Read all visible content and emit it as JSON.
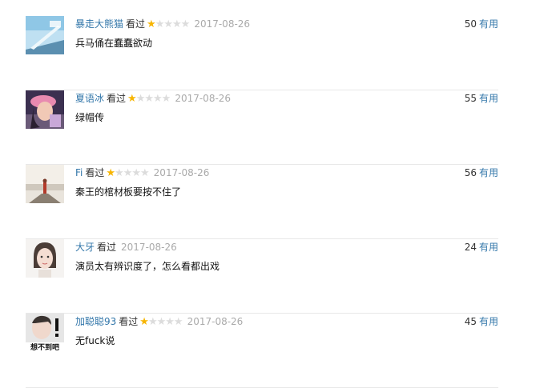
{
  "comments": [
    {
      "user": "暴走大熊猫",
      "status": "看过",
      "rating": 1,
      "max_rating": 5,
      "date": "2017-08-26",
      "text": "兵马俑在蠢蠢欲动",
      "votes": "50",
      "vote_label": "有用",
      "avatar": "avatar-stairs-sky"
    },
    {
      "user": "夏语冰",
      "status": "看过",
      "rating": 1,
      "max_rating": 5,
      "date": "2017-08-26",
      "text": "绿帽传",
      "votes": "55",
      "vote_label": "有用",
      "avatar": "avatar-girl-pink-hat"
    },
    {
      "user": "Fi",
      "status": "看过",
      "rating": 1,
      "max_rating": 5,
      "date": "2017-08-26",
      "text": "秦王的棺材板要按不住了",
      "votes": "56",
      "vote_label": "有用",
      "avatar": "avatar-figure-on-rock-sea"
    },
    {
      "user": "大牙",
      "status": "看过",
      "rating": null,
      "max_rating": 5,
      "date": "2017-08-26",
      "text": "演员太有辨识度了，怎么看都出戏",
      "votes": "24",
      "vote_label": "有用",
      "avatar": "avatar-girl-portrait"
    },
    {
      "user": "加聪聪93",
      "status": "看过",
      "rating": 1,
      "max_rating": 5,
      "date": "2017-08-26",
      "text": "无fuck说",
      "votes": "45",
      "vote_label": "有用",
      "avatar": "avatar-meme-face",
      "avatar_caption": "想不到吧"
    }
  ],
  "colors": {
    "link": "#3377aa",
    "star_on": "#f7b500",
    "star_off": "#dcdcdc",
    "date": "#aaaaaa",
    "divider": "#e8e8e8"
  }
}
